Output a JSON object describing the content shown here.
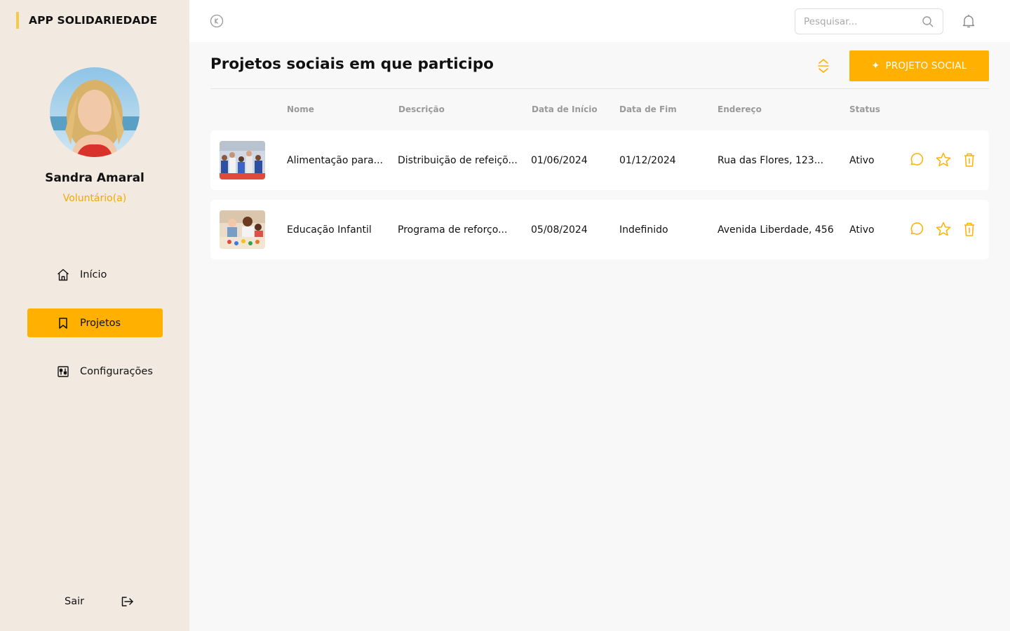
{
  "app": {
    "brand": "APP SOLIDARIEDADE"
  },
  "colors": {
    "accent": "#ffb000",
    "sidebar_bg": "#f2e9e0",
    "role_text": "#f5a800"
  },
  "user": {
    "name": "Sandra Amaral",
    "role": "Voluntário(a)"
  },
  "sidebar": {
    "items": [
      {
        "label": "Início",
        "icon": "home-icon",
        "active": false
      },
      {
        "label": "Projetos",
        "icon": "bookmark-icon",
        "active": true
      },
      {
        "label": "Configurações",
        "icon": "settings-icon",
        "active": false
      }
    ],
    "logout_label": "Sair"
  },
  "search": {
    "placeholder": "Pesquisar..."
  },
  "main": {
    "title": "Projetos sociais em que participo",
    "add_button_label": "PROJETO SOCIAL",
    "columns": [
      "Nome",
      "Descrição",
      "Data de Início",
      "Data de Fim",
      "Endereço",
      "Status"
    ],
    "rows": [
      {
        "nome": "Alimentação para...",
        "descricao": "Distribuição de refeiçõ...",
        "inicio": "01/06/2024",
        "fim": "01/12/2024",
        "endereco": "Rua das Flores, 123...",
        "status": "Ativo"
      },
      {
        "nome": "Educação Infantil",
        "descricao": "Programa de reforço...",
        "inicio": "05/08/2024",
        "fim": "Indefinido",
        "endereco": "Avenida Liberdade, 456",
        "status": "Ativo"
      }
    ]
  }
}
